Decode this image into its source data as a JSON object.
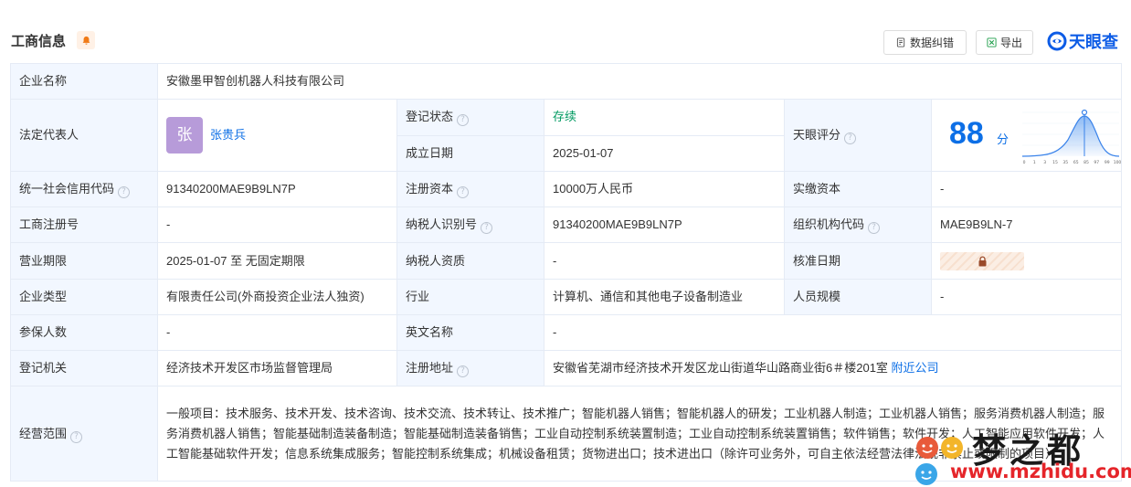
{
  "header": {
    "title": "工商信息",
    "btn_fix": "数据纠错",
    "btn_export": "导出",
    "logo": "天眼查"
  },
  "rows": {
    "company_name": {
      "label": "企业名称",
      "value": "安徽墨甲智创机器人科技有限公司"
    },
    "legal_rep": {
      "label": "法定代表人",
      "avatar": "张",
      "name": "张贵兵"
    },
    "reg_status": {
      "label": "登记状态",
      "value": "存续"
    },
    "est_date": {
      "label": "成立日期",
      "value": "2025-01-07"
    },
    "rating": {
      "label": "天眼评分",
      "score": "88",
      "unit": "分",
      "ticks": [
        "0",
        "1",
        "3",
        "15",
        "35",
        "65",
        "85",
        "97",
        "99",
        "100"
      ]
    },
    "credit_code": {
      "label": "统一社会信用代码",
      "value": "91340200MAE9B9LN7P"
    },
    "reg_capital": {
      "label": "注册资本",
      "value": "10000万人民币"
    },
    "paid_capital": {
      "label": "实缴资本",
      "value": "-"
    },
    "reg_no": {
      "label": "工商注册号",
      "value": "-"
    },
    "taxpayer_id": {
      "label": "纳税人识别号",
      "value": "91340200MAE9B9LN7P"
    },
    "org_code": {
      "label": "组织机构代码",
      "value": "MAE9B9LN-7"
    },
    "term": {
      "label": "营业期限",
      "value": "2025-01-07 至 无固定期限"
    },
    "taxpayer_qual": {
      "label": "纳税人资质",
      "value": "-"
    },
    "approve_date": {
      "label": "核准日期"
    },
    "company_type": {
      "label": "企业类型",
      "value": "有限责任公司(外商投资企业法人独资)"
    },
    "industry": {
      "label": "行业",
      "value": "计算机、通信和其他电子设备制造业"
    },
    "staff_size": {
      "label": "人员规模",
      "value": "-"
    },
    "insured": {
      "label": "参保人数",
      "value": "-"
    },
    "english_name": {
      "label": "英文名称",
      "value": "-"
    },
    "reg_authority": {
      "label": "登记机关",
      "value": "经济技术开发区市场监督管理局"
    },
    "reg_address": {
      "label": "注册地址",
      "value": "安徽省芜湖市经济技术开发区龙山街道华山路商业街6＃楼201室",
      "link": "附近公司"
    },
    "scope": {
      "label": "经营范围",
      "value": "一般项目：技术服务、技术开发、技术咨询、技术交流、技术转让、技术推广；智能机器人销售；智能机器人的研发；工业机器人制造；工业机器人销售；服务消费机器人制造；服务消费机器人销售；智能基础制造装备制造；智能基础制造装备销售；工业自动控制系统装置制造；工业自动控制系统装置销售；软件销售；软件开发；人工智能应用软件开发；人工智能基础软件开发；信息系统集成服务；智能控制系统集成；机械设备租赁；货物进出口；技术进出口（除许可业务外，可自主依法经营法律法规非禁止或限制的项目）"
    }
  },
  "watermark": {
    "text": "梦之都",
    "url": "www.mzhidu.com"
  }
}
